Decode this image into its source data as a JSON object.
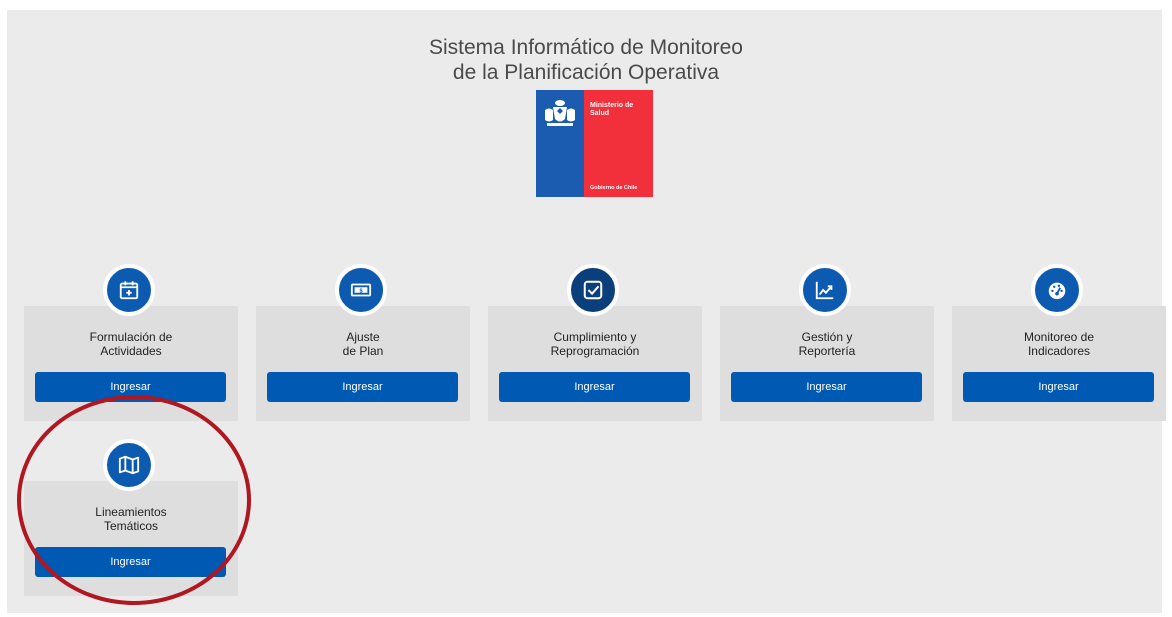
{
  "header": {
    "title_line1": "Sistema Informático de Monitoreo",
    "title_line2": "de la Planificación Operativa"
  },
  "logo": {
    "ministry_line1": "Ministerio de",
    "ministry_line2": "Salud",
    "government": "Gobierno de Chile",
    "colors": {
      "blue": "#1c5cb0",
      "red": "#f1303b"
    }
  },
  "modules": [
    {
      "icon": "calendar-plus-icon",
      "label_line1": "Formulación de",
      "label_line2": "Actividades",
      "button": "Ingresar"
    },
    {
      "icon": "money-bill-icon",
      "label_line1": "Ajuste",
      "label_line2": "de Plan",
      "button": "Ingresar"
    },
    {
      "icon": "check-square-icon",
      "label_line1": "Cumplimiento y",
      "label_line2": "Reprogramación",
      "button": "Ingresar"
    },
    {
      "icon": "line-chart-icon",
      "label_line1": "Gestión y",
      "label_line2": "Reportería",
      "button": "Ingresar"
    },
    {
      "icon": "dashboard-gauge-icon",
      "label_line1": "Monitoreo de",
      "label_line2": "Indicadores",
      "button": "Ingresar"
    },
    {
      "icon": "map-icon",
      "label_line1": "Lineamientos",
      "label_line2": "Temáticos",
      "button": "Ingresar"
    }
  ],
  "colors": {
    "button_blue": "#0059b2",
    "icon_circle_blue": "#0d5bb1",
    "icon_circle_active": "#0b3f7c",
    "highlight_red": "#b01720"
  }
}
